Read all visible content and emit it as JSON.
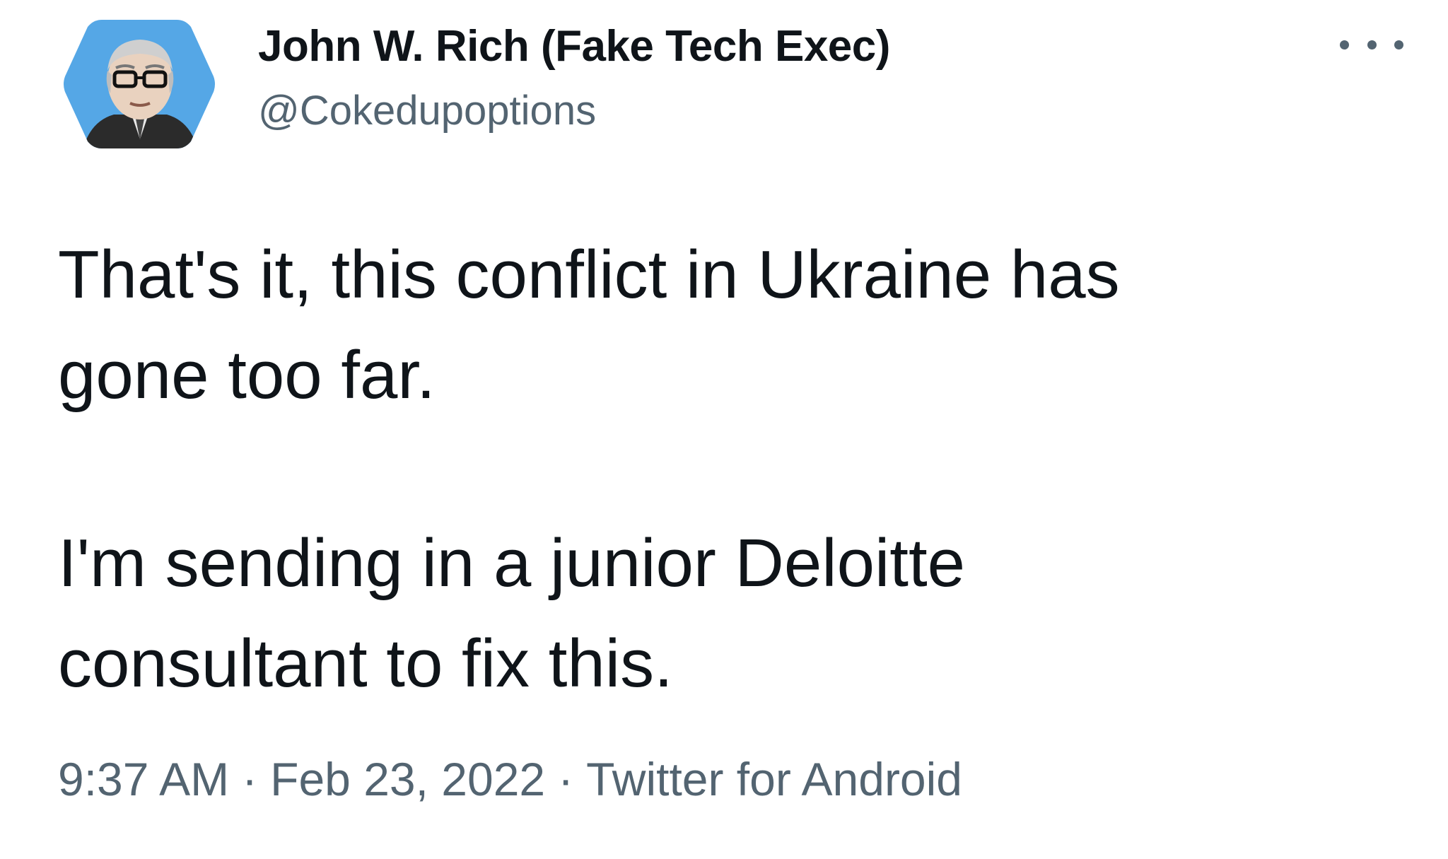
{
  "author": {
    "display_name": "John W. Rich (Fake Tech Exec)",
    "handle": "@Cokedupoptions",
    "avatar_icon": "profile-avatar-illustration",
    "avatar_bg_color": "#55a7e6"
  },
  "more_icon": "ellipsis-icon",
  "tweet": {
    "paragraphs": [
      {
        "lines": [
          "That's it, this conflict in Ukraine has",
          "gone too far."
        ]
      },
      {
        "lines": [
          "I'm sending in a junior Deloitte",
          "consultant to fix this."
        ]
      }
    ]
  },
  "meta": {
    "time": "9:37 AM",
    "separator": "·",
    "date": "Feb 23, 2022",
    "source": "Twitter for Android"
  },
  "colors": {
    "text_primary": "#0f1419",
    "text_secondary": "#536471"
  }
}
